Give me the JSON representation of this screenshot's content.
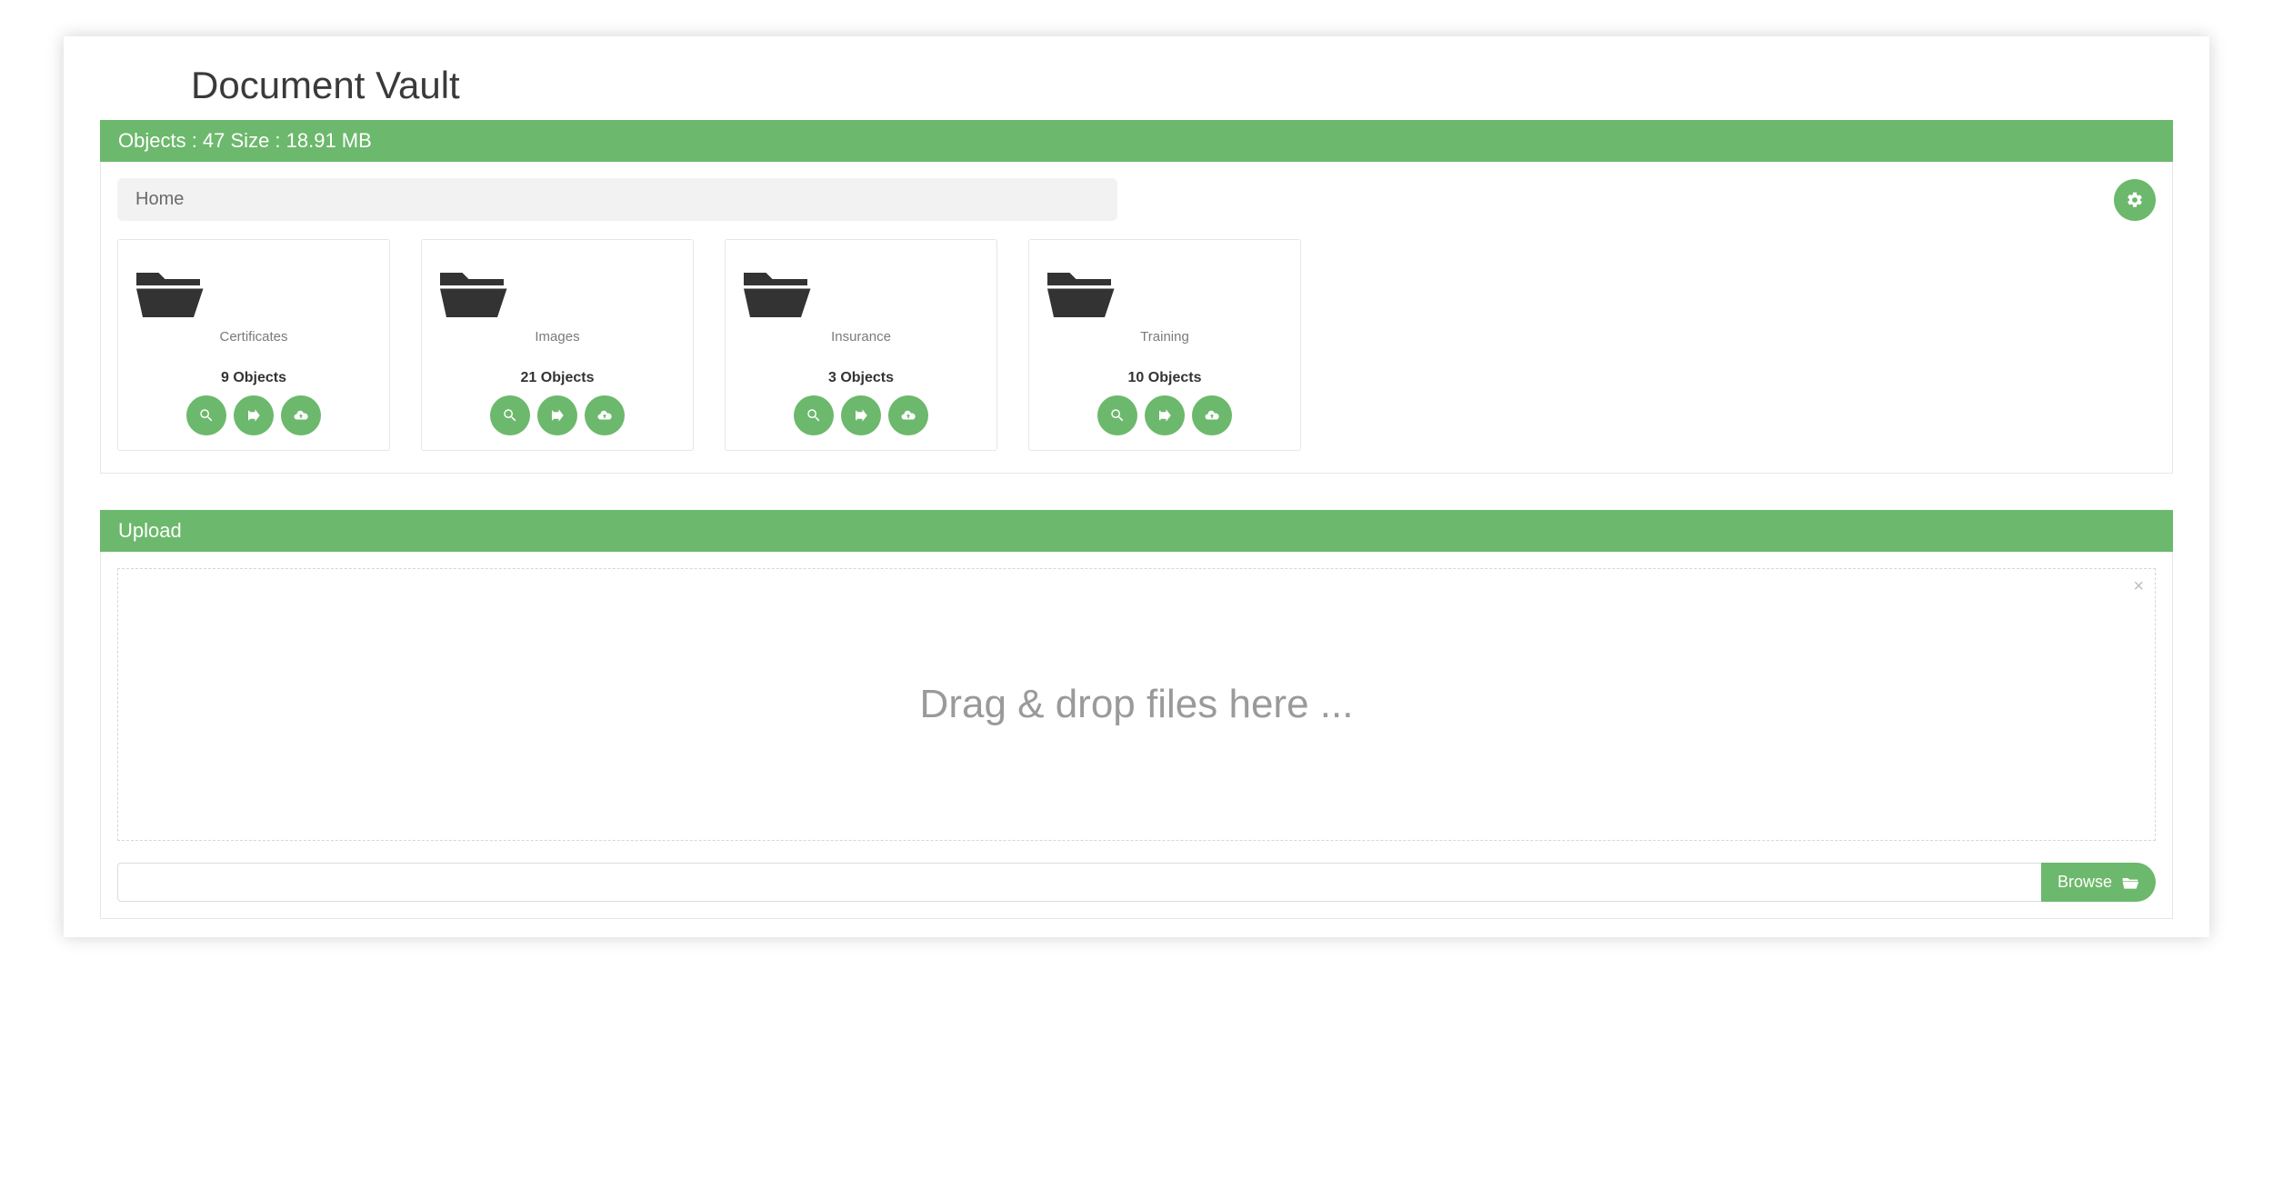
{
  "page": {
    "title": "Document Vault"
  },
  "status_bar": {
    "text": "Objects : 47 Size : 18.91 MB"
  },
  "breadcrumb": {
    "label": "Home"
  },
  "folders": [
    {
      "name": "Certificates",
      "count_label": "9 Objects"
    },
    {
      "name": "Images",
      "count_label": "21 Objects"
    },
    {
      "name": "Insurance",
      "count_label": "3 Objects"
    },
    {
      "name": "Training",
      "count_label": "10 Objects"
    }
  ],
  "upload": {
    "header": "Upload",
    "dropzone_text": "Drag & drop files here ...",
    "browse_label": "Browse",
    "file_input_value": ""
  }
}
